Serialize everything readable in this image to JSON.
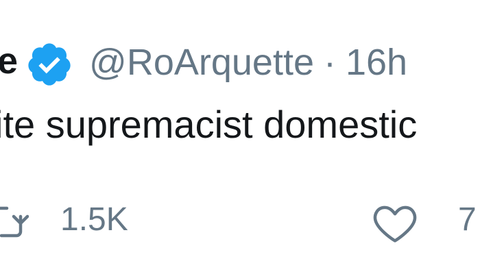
{
  "tweet": {
    "author_name_visible": "e",
    "verified_icon": "verified-badge-icon",
    "handle": "@RoArquette",
    "separator": "·",
    "timestamp": "16h",
    "text_visible": "ite supremacist domestic"
  },
  "actions": {
    "retweet": {
      "icon": "retweet-icon",
      "count": "1.5K"
    },
    "like": {
      "icon": "heart-icon",
      "count": "7"
    }
  },
  "colors": {
    "verified_blue": "#1da1f2",
    "text_primary": "#14171a",
    "text_secondary": "#657786",
    "background": "#ffffff"
  }
}
